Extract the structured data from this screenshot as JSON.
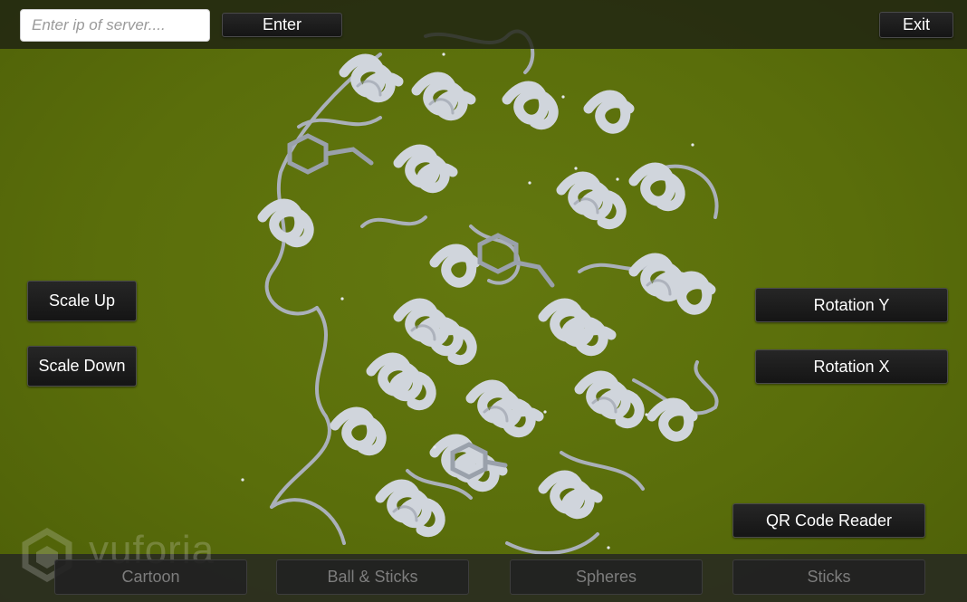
{
  "top_bar": {
    "ip_input": {
      "placeholder": "Enter ip of server....",
      "value": ""
    },
    "enter_label": "Enter",
    "exit_label": "Exit"
  },
  "left_controls": {
    "scale_up_label": "Scale Up",
    "scale_down_label": "Scale Down"
  },
  "right_controls": {
    "rotation_y_label": "Rotation Y",
    "rotation_x_label": "Rotation X",
    "qr_label": "QR Code Reader"
  },
  "display_modes": [
    {
      "label": "Cartoon"
    },
    {
      "label": "Ball & Sticks"
    },
    {
      "label": "Spheres"
    },
    {
      "label": "Sticks"
    }
  ],
  "watermark": {
    "text": "vuforia"
  },
  "viewport": {
    "background_color": "#5a6e0b",
    "molecule_color": "#c9ced6",
    "icon": "protein-ribbon-model"
  }
}
